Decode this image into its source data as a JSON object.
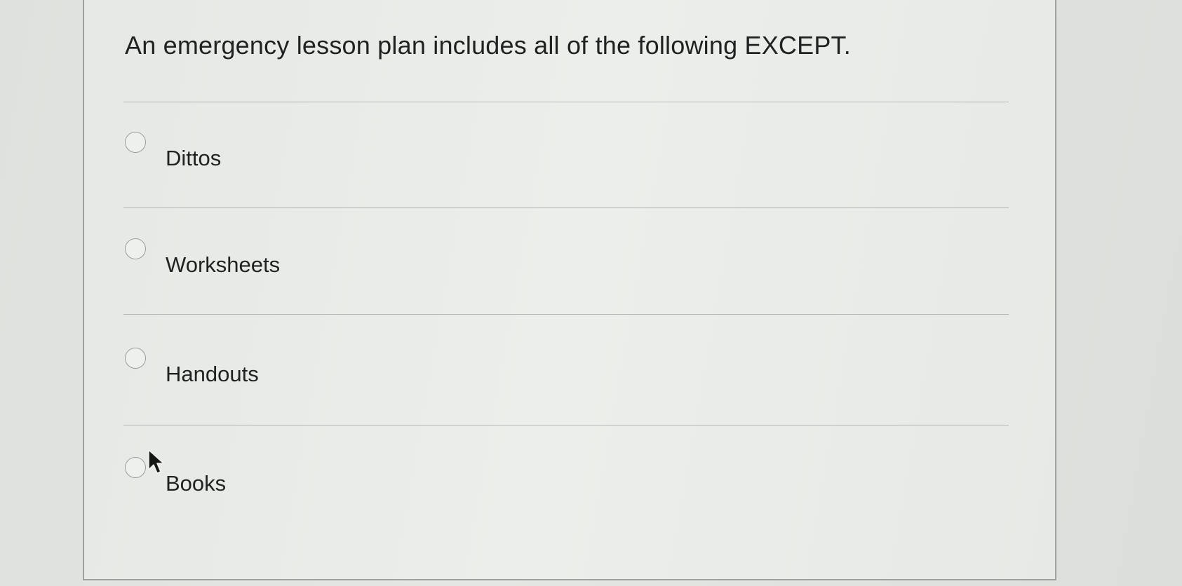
{
  "question": {
    "text": "An emergency lesson plan includes all of the following EXCEPT."
  },
  "options": [
    {
      "label": "Dittos",
      "selected": false
    },
    {
      "label": "Worksheets",
      "selected": false
    },
    {
      "label": "Handouts",
      "selected": false
    },
    {
      "label": "Books",
      "selected": false
    }
  ],
  "colors": {
    "text": "#1f2220",
    "card_background": "#eceeeb",
    "page_background": "#dcdedb",
    "border": "#9ea19e"
  },
  "icons": {
    "radio": "radio-button-icon",
    "pointer": "mouse-pointer-icon"
  }
}
